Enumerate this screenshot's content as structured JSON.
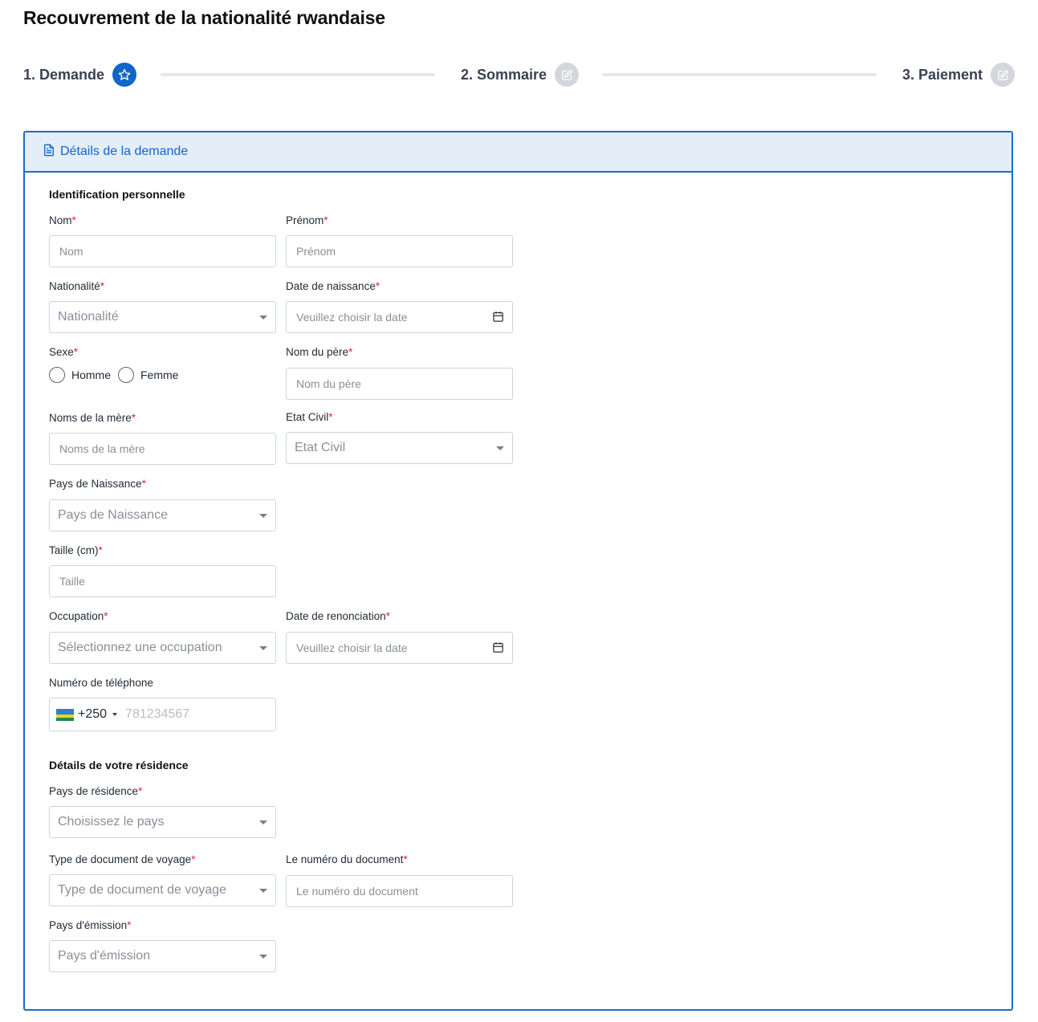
{
  "page": {
    "title": "Recouvrement de la nationalité rwandaise"
  },
  "steps": [
    {
      "label": "1. Demande",
      "state": "active",
      "icon": "star-icon"
    },
    {
      "label": "2. Sommaire",
      "state": "inactive",
      "icon": "edit-icon"
    },
    {
      "label": "3. Paiement",
      "state": "inactive",
      "icon": "edit-icon"
    }
  ],
  "card": {
    "title": "Détails de la demande",
    "icon": "document-icon"
  },
  "sections": {
    "personal": "Identification personnelle",
    "residence": "Détails de votre résidence"
  },
  "fields": {
    "nom": {
      "label": "Nom",
      "required": "*",
      "placeholder": "Nom"
    },
    "prenom": {
      "label": "Prénom",
      "required": "*",
      "placeholder": "Prénom"
    },
    "nationalite": {
      "label": "Nationalité",
      "required": "*",
      "placeholder": "Nationalité"
    },
    "date_naissance": {
      "label": "Date de naissance",
      "required": "*",
      "placeholder": "Veuillez choisir la date"
    },
    "sexe": {
      "label": "Sexe",
      "required": "*",
      "options": [
        "Homme",
        "Femme"
      ]
    },
    "nom_pere": {
      "label": "Nom du père",
      "required": "*",
      "placeholder": "Nom du père"
    },
    "noms_mere": {
      "label": "Noms de la mère",
      "required": "*",
      "placeholder": "Noms de la mère"
    },
    "etat_civil": {
      "label": "Etat Civil",
      "required": "*",
      "placeholder": "Etat Civil"
    },
    "pays_naissance": {
      "label": "Pays de Naissance",
      "required": "*",
      "placeholder": "Pays de Naissance"
    },
    "taille": {
      "label": "Taille (cm)",
      "required": "*",
      "placeholder": "Taille"
    },
    "occupation": {
      "label": "Occupation",
      "required": "*",
      "placeholder": "Sélectionnez une occupation"
    },
    "date_renonciation": {
      "label": "Date de renonciation",
      "required": "*",
      "placeholder": "Veuillez choisir la date"
    },
    "telephone": {
      "label": "Numéro de téléphone",
      "country_code": "+250",
      "placeholder": "781234567",
      "flag": "rwanda-flag"
    },
    "pays_residence": {
      "label": "Pays de résidence",
      "required": "*",
      "placeholder": "Choisissez le pays"
    },
    "type_document": {
      "label": "Type de document de voyage",
      "required": "*",
      "placeholder": "Type de document de voyage"
    },
    "numero_document": {
      "label": "Le numéro du document",
      "required": "*",
      "placeholder": "Le numéro du document"
    },
    "pays_emission": {
      "label": "Pays d'émission",
      "required": "*",
      "placeholder": "Pays d'émission"
    }
  },
  "colors": {
    "accent": "#1167c8",
    "required": "#e0263a",
    "header_bg": "#e3eef9"
  }
}
